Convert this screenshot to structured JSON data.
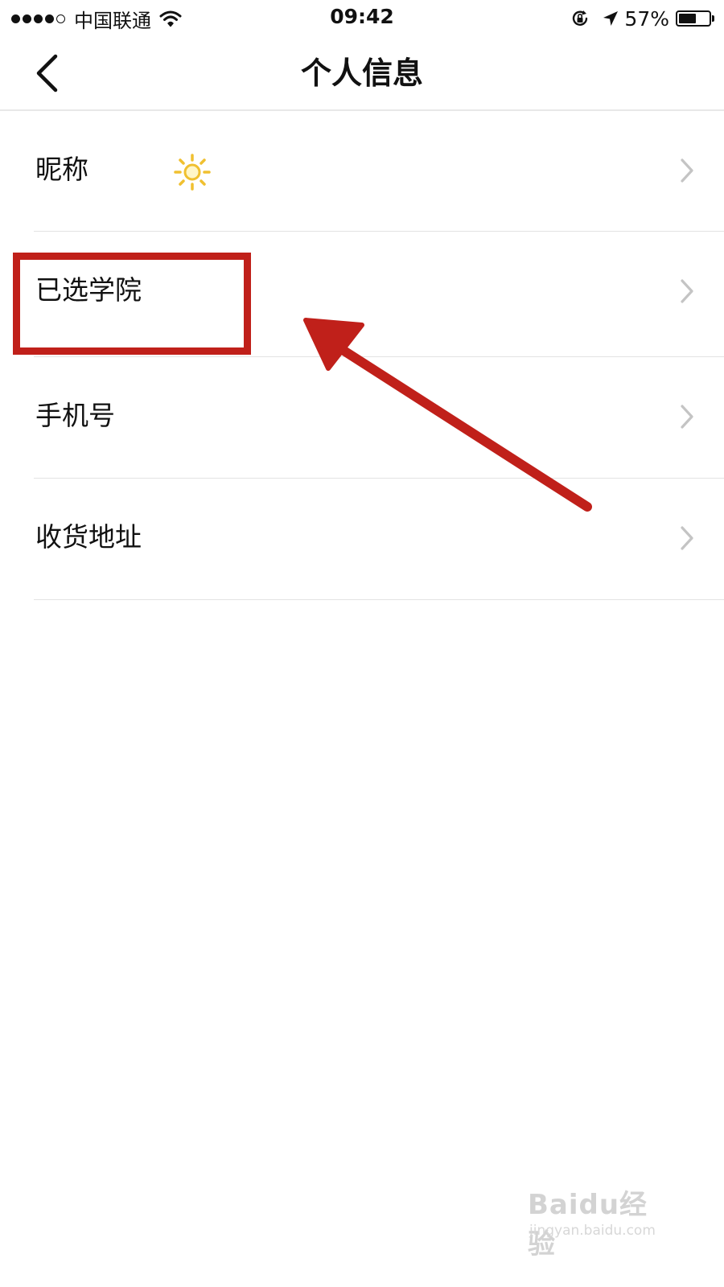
{
  "status_bar": {
    "carrier": "中国联通",
    "time": "09:42",
    "battery_percent": "57%",
    "battery_level": 0.57,
    "signal_bars_filled": 4,
    "signal_bars_total": 5
  },
  "nav": {
    "title": "个人信息",
    "back_icon": "chevron-left-icon"
  },
  "rows": [
    {
      "label": "昵称",
      "value_icon": "sun-icon"
    },
    {
      "label": "已选学院"
    },
    {
      "label": "手机号"
    },
    {
      "label": "收货地址"
    }
  ],
  "annotation": {
    "highlight_color": "#c0201a",
    "highlighted_row": "已选学院"
  },
  "watermark": {
    "brand": "Baidu经验",
    "url": "jingyan.baidu.com"
  }
}
